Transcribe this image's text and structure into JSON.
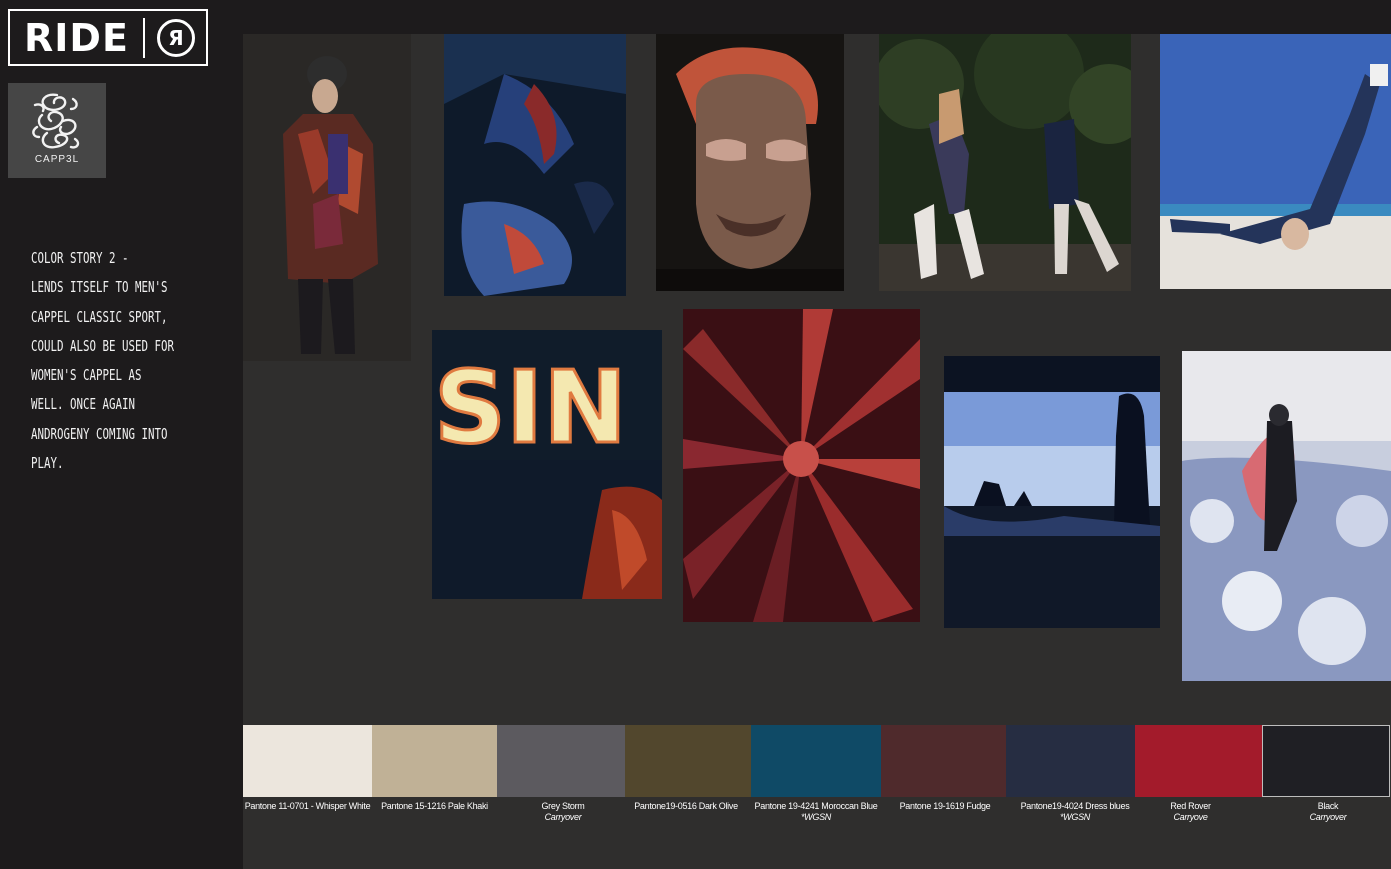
{
  "brand": {
    "ride_word": "RIDE",
    "ride_mark": "R",
    "cappel_name": "CAPP3L"
  },
  "story": {
    "lines": [
      "Color story  2 -",
      "lends itself to men's",
      "Cappel classic sport,",
      "could also be used for",
      "Women's Cappel as",
      "well.  Once again",
      "androgeny coming into",
      "play."
    ]
  },
  "photos": {
    "sign_text": "SIN"
  },
  "palette": [
    {
      "name": "Pantone 11-0701 - Whisper White",
      "note": "",
      "color": "#ece6dd"
    },
    {
      "name": "Pantone 15-1216 Pale Khaki",
      "note": "",
      "color": "#c0b196"
    },
    {
      "name": "Grey Storm",
      "note": "Carryover",
      "color": "#5c5a5f"
    },
    {
      "name": "Pantone19-0516 Dark Olive",
      "note": "",
      "color": "#52472d"
    },
    {
      "name": "Pantone 19-4241 Moroccan Blue",
      "note": "*WGSN",
      "color": "#0f4a66"
    },
    {
      "name": "Pantone 19-1619 Fudge",
      "note": "",
      "color": "#4f2a2c"
    },
    {
      "name": "Pantone19-4024 Dress blues",
      "note": "*WGSN",
      "color": "#262d42"
    },
    {
      "name": "Red Rover",
      "note": "Carryove",
      "color": "#a31b2b"
    },
    {
      "name": "Black",
      "note": "Carryover",
      "color": "#1f1f24"
    }
  ]
}
